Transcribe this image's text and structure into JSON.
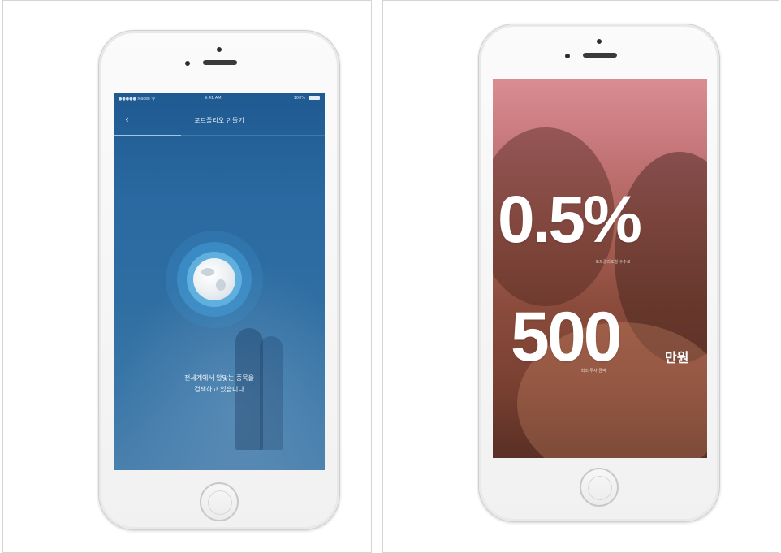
{
  "left_phone": {
    "status_bar": {
      "carrier": "●●●●● Nacell 令",
      "time": "9:41 AM",
      "battery": "100%"
    },
    "nav": {
      "back_icon": "chevron-left-icon",
      "title": "포트폴리오 만들기"
    },
    "progress": {
      "fraction": 0.32
    },
    "message_line1": "전세계에서 알맞는 종목을",
    "message_line2": "검색하고 있습니다",
    "colors": {
      "screen_top": "#1f5a91",
      "screen_bottom": "#4a80ad",
      "accent": "#5fb0de"
    }
  },
  "right_phone": {
    "stat1_value": "0.5%",
    "stat1_caption": "포트폴리오별 수수료",
    "stat2_value": "500",
    "stat2_unit": "만원",
    "stat2_caption": "최소 투자 금액",
    "colors": {
      "screen_top": "#d98e93",
      "screen_bottom": "#5a2f25",
      "text": "#ffffff"
    }
  }
}
